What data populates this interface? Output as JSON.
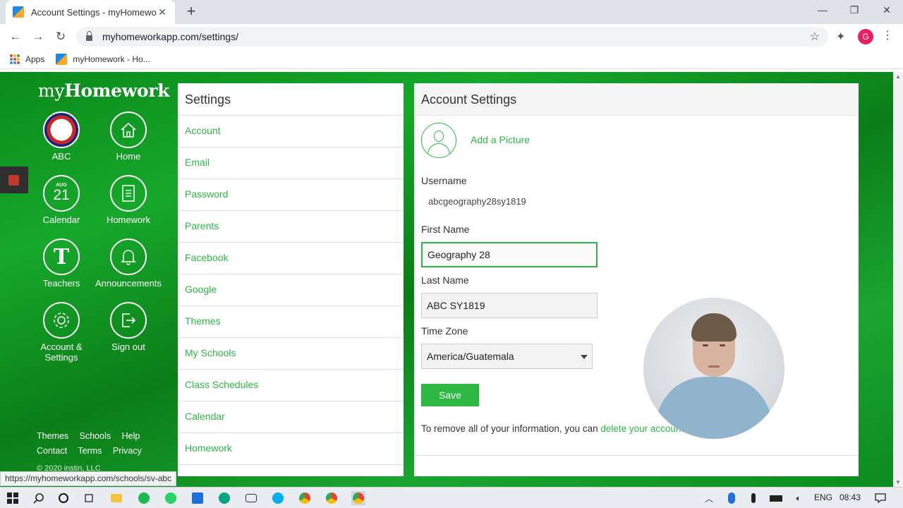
{
  "browser": {
    "tab_title": "Account Settings - myHomework",
    "tab_close": "✕",
    "new_tab": "+",
    "win_minimize": "—",
    "win_restore": "❐",
    "win_close": "✕",
    "back": "←",
    "forward": "→",
    "reload": "↻",
    "url": "myhomeworkapp.com/settings/",
    "star": "☆",
    "extension": "✦",
    "profile_initial": "G",
    "menu": "⋮",
    "bookmarks": [
      "Apps",
      "myHomework - Ho..."
    ],
    "status_url": "https://myhomeworkapp.com/schools/sv-abc"
  },
  "sidebar": {
    "logo_prefix": "my",
    "logo_brand": "Homework",
    "tiles": [
      {
        "label": "ABC",
        "icon": "school-crest-icon"
      },
      {
        "label": "Home",
        "icon": "home-icon"
      },
      {
        "label": "Calendar",
        "icon": "calendar-icon",
        "month": "AUG",
        "day": "21"
      },
      {
        "label": "Homework",
        "icon": "document-icon"
      },
      {
        "label": "Teachers",
        "icon": "teacher-icon",
        "glyph": "T"
      },
      {
        "label": "Announcements",
        "icon": "bell-icon"
      },
      {
        "label": "Account & Settings",
        "icon": "gear-icon"
      },
      {
        "label": "Sign out",
        "icon": "sign-out-icon"
      }
    ],
    "footer_row1": [
      "Themes",
      "Schools",
      "Help"
    ],
    "footer_row2": [
      "Contact",
      "Terms",
      "Privacy"
    ],
    "copyright": "© 2020 instin, LLC"
  },
  "settings_menu": {
    "title": "Settings",
    "items": [
      "Account",
      "Email",
      "Password",
      "Parents",
      "Facebook",
      "Google",
      "Themes",
      "My Schools",
      "Class Schedules",
      "Calendar",
      "Homework"
    ]
  },
  "account": {
    "title": "Account Settings",
    "add_picture": "Add a Picture",
    "username_label": "Username",
    "username_value": "abcgeography28sy1819",
    "first_name_label": "First Name",
    "first_name_value": "Geography 28",
    "last_name_label": "Last Name",
    "last_name_value": "ABC SY1819",
    "time_zone_label": "Time Zone",
    "time_zone_value": "America/Guatemala",
    "save_label": "Save",
    "remove_text": "To remove all of your information, you can ",
    "remove_link": "delete your account"
  },
  "taskbar": {
    "language": "ENG",
    "time": "08:43"
  },
  "colors": {
    "accent_green": "#2db843",
    "page_green": "#0f9a22"
  }
}
